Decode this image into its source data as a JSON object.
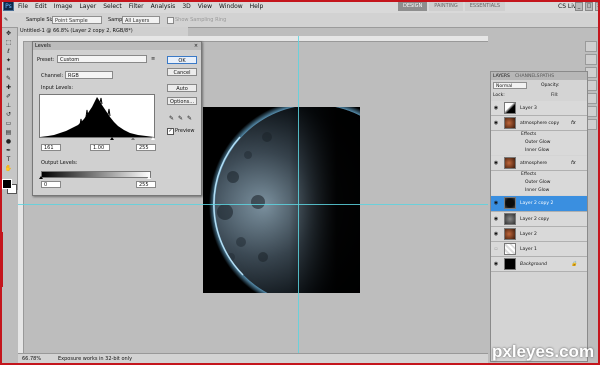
{
  "menubar": {
    "logo": "Ps",
    "items": [
      "File",
      "Edit",
      "Image",
      "Layer",
      "Select",
      "Filter",
      "Analysis",
      "3D",
      "View",
      "Window",
      "Help"
    ],
    "workspaces": [
      "DESIGN",
      "PAINTING",
      "ESSENTIALS"
    ],
    "cs_live": "CS Live"
  },
  "options": {
    "sample_size_label": "Sample Size:",
    "sample_size_value": "Point Sample",
    "sample_label": "Sample:",
    "sample_value": "All Layers",
    "show_ring": "Show Sampling Ring"
  },
  "document": {
    "tab_title": "Untitled-1 @ 66.8% (Layer 2 copy 2, RGB/8*)",
    "zoom": "66.78%",
    "status": "Exposure works in 32-bit only"
  },
  "levels": {
    "title": "Levels",
    "preset_label": "Preset:",
    "preset_value": "Custom",
    "channel_label": "Channel:",
    "channel_value": "RGB",
    "input_levels_label": "Input Levels:",
    "input_black": "161",
    "input_gamma": "1.00",
    "input_white": "255",
    "output_levels_label": "Output Levels:",
    "output_black": "0",
    "output_white": "255",
    "buttons": [
      "OK",
      "Cancel",
      "Auto",
      "Options..."
    ],
    "preview_label": "Preview"
  },
  "layers": {
    "tabs": [
      "LAYERS",
      "CHANNELS",
      "PATHS"
    ],
    "blend_mode": "Normal",
    "opacity_label": "Opacity:",
    "lock_label": "Lock:",
    "fill_label": "Fill:",
    "rows": [
      {
        "name": "Layer 3",
        "thumb": "stroke"
      },
      {
        "name": "atmosphere copy",
        "thumb": "planet",
        "fx": "fx"
      },
      {
        "name": "Effects",
        "sub": true
      },
      {
        "name": "Outer Glow",
        "sub": true
      },
      {
        "name": "Inner Glow",
        "sub": true
      },
      {
        "name": "atmosphere",
        "thumb": "planet",
        "fx": "fx"
      },
      {
        "name": "Effects",
        "sub": true
      },
      {
        "name": "Outer Glow",
        "sub": true
      },
      {
        "name": "Inner Glow",
        "sub": true
      },
      {
        "name": "Layer 2 copy 2",
        "thumb": "black",
        "selected": true
      },
      {
        "name": "Layer 2 copy",
        "thumb": "gray"
      },
      {
        "name": "Layer 2",
        "thumb": "planet"
      },
      {
        "name": "Layer 1",
        "thumb": "white"
      },
      {
        "name": "Background",
        "thumb": "black"
      }
    ]
  },
  "watermark": "pxleyes.com",
  "colors": {
    "accent": "#3a8fe0",
    "guide": "#5dd4df",
    "frame": "#c4151c",
    "atmosphere": "#7fd0ff"
  }
}
